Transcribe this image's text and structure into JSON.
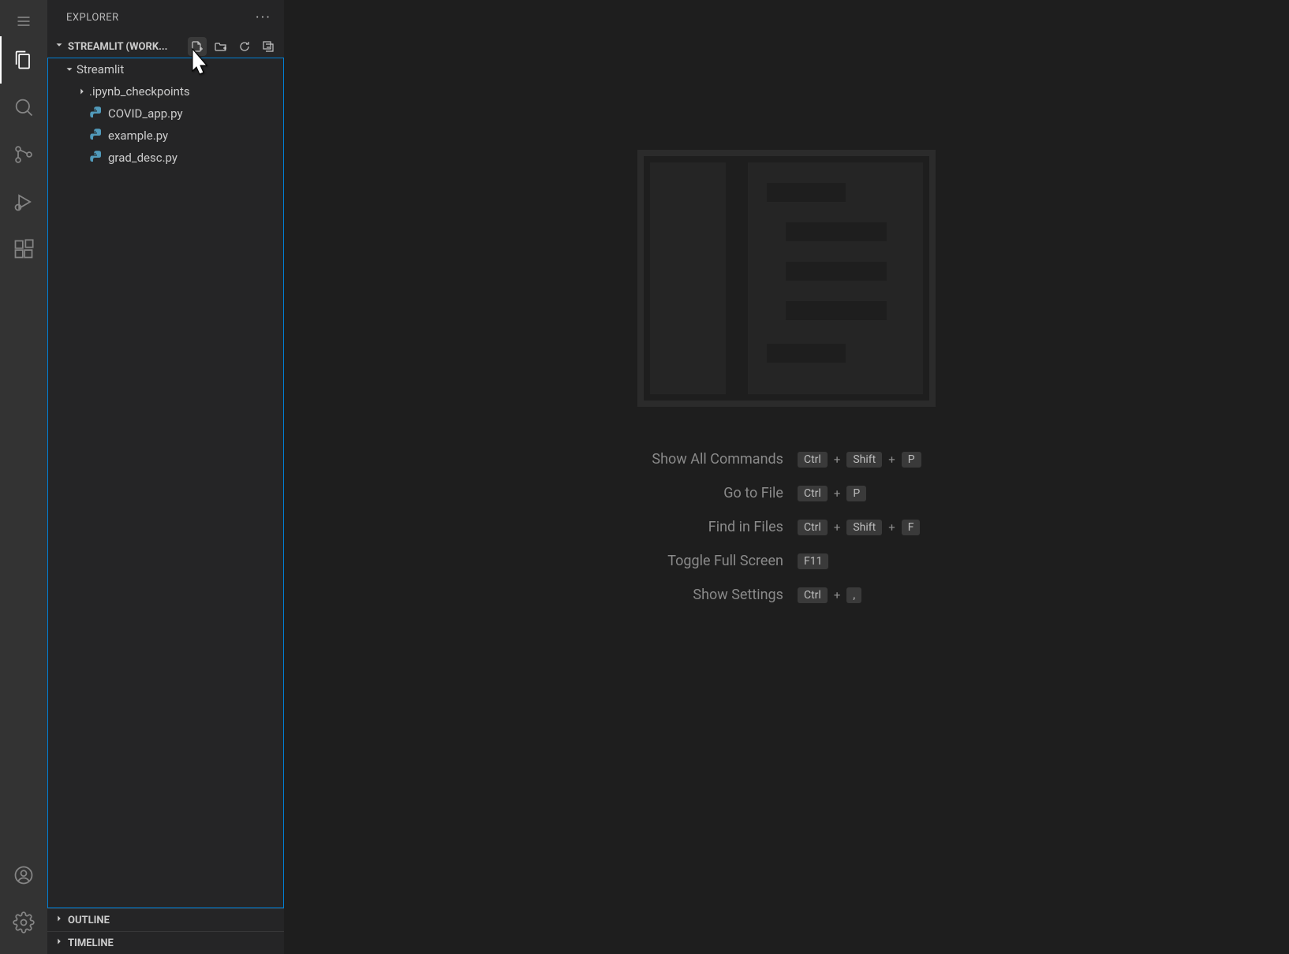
{
  "sidebar": {
    "title": "EXPLORER",
    "workspace_label": "STREAMLIT (WORK...",
    "folder": {
      "name": "Streamlit",
      "children": [
        {
          "type": "folder",
          "name": ".ipynb_checkpoints"
        },
        {
          "type": "file",
          "name": "COVID_app.py",
          "icon": "python"
        },
        {
          "type": "file",
          "name": "example.py",
          "icon": "python"
        },
        {
          "type": "file",
          "name": "grad_desc.py",
          "icon": "python"
        }
      ]
    },
    "panels": {
      "outline": "OUTLINE",
      "timeline": "TIMELINE"
    }
  },
  "welcome": {
    "shortcuts": [
      {
        "label": "Show All Commands",
        "keys": [
          "Ctrl",
          "Shift",
          "P"
        ]
      },
      {
        "label": "Go to File",
        "keys": [
          "Ctrl",
          "P"
        ]
      },
      {
        "label": "Find in Files",
        "keys": [
          "Ctrl",
          "Shift",
          "F"
        ]
      },
      {
        "label": "Toggle Full Screen",
        "keys": [
          "F11"
        ]
      },
      {
        "label": "Show Settings",
        "keys": [
          "Ctrl",
          ","
        ]
      }
    ]
  }
}
